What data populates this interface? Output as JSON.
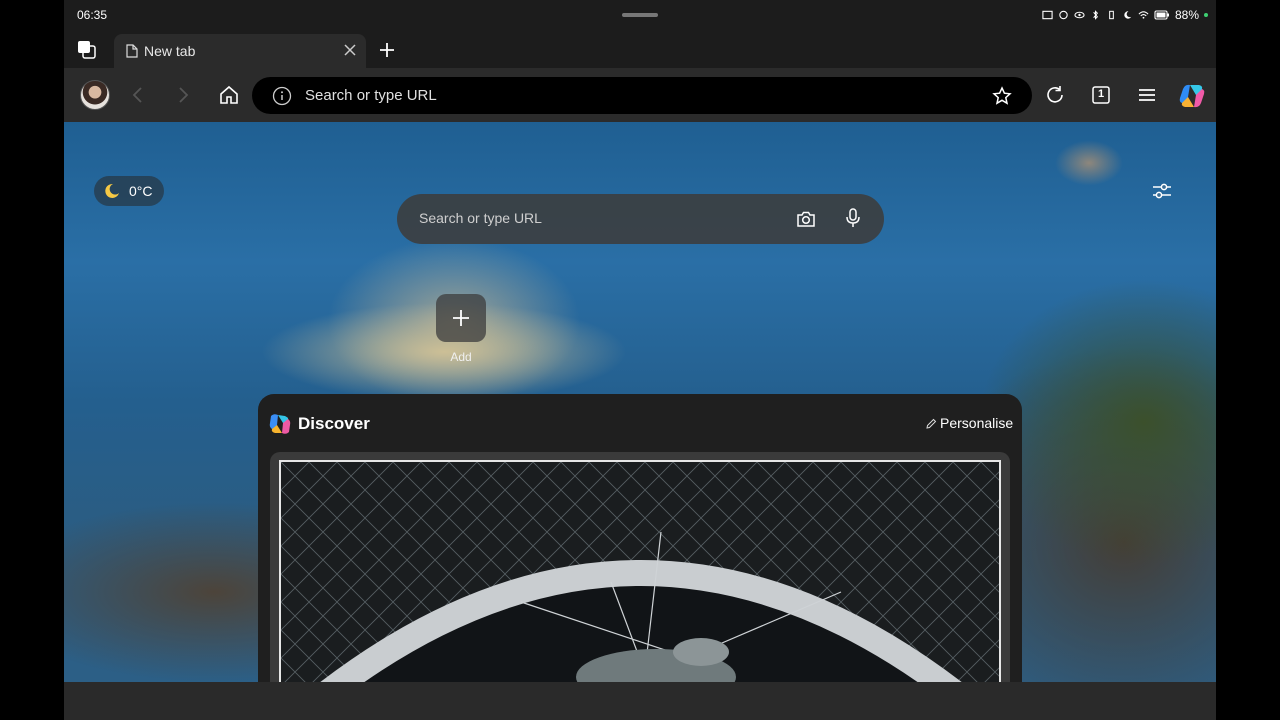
{
  "status_bar": {
    "time": "06:35",
    "battery": "88%"
  },
  "tab_strip": {
    "tabs": [
      {
        "title": "New tab",
        "active": true
      }
    ]
  },
  "toolbar": {
    "address_placeholder": "Search or type URL",
    "tab_count": "1"
  },
  "new_tab_page": {
    "weather": {
      "temperature": "0°C",
      "icon": "moon-icon"
    },
    "search": {
      "placeholder": "Search or type URL"
    },
    "quick_links": {
      "add_label": "Add"
    },
    "discover": {
      "title": "Discover",
      "personalise_label": "Personalise"
    }
  },
  "colors": {
    "toolbar_bg": "#2b2b2b",
    "omnibox_bg": "#000000",
    "panel_bg": "#1f1f1f",
    "battery_dot": "#3ecf71"
  }
}
